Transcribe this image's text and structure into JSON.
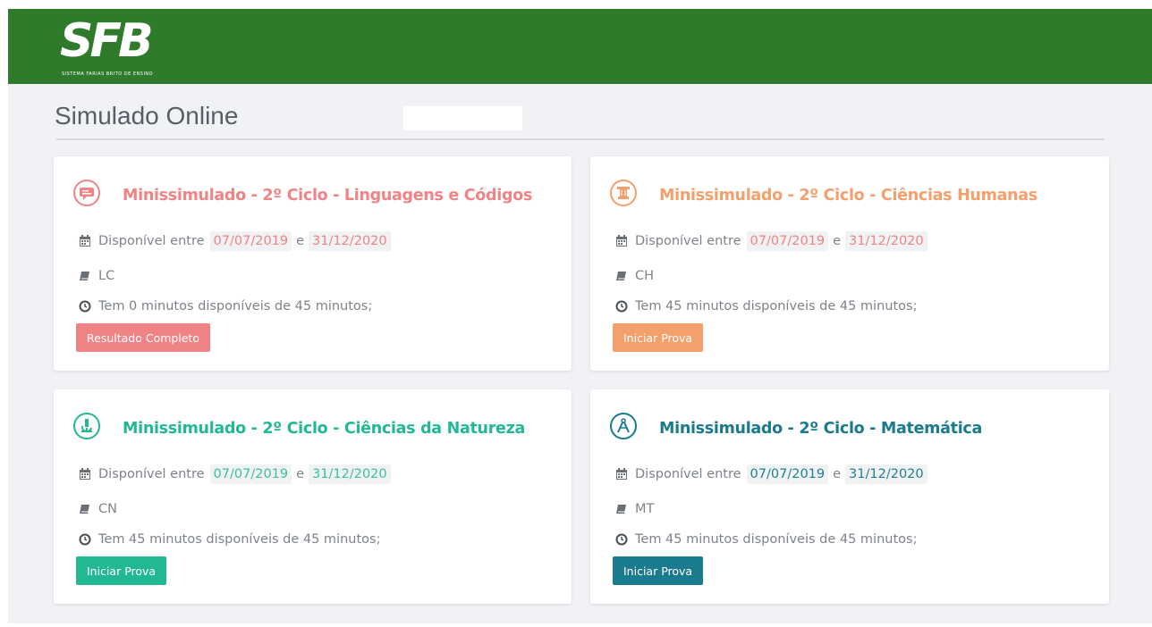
{
  "header": {
    "logo_text": "SFB",
    "logo_tagline": "SISTEMA FARIAS BRITO DE ENSINO",
    "bg_color": "#2f7b2b"
  },
  "page": {
    "title": "Simulado Online"
  },
  "cards": [
    {
      "title": "Minissimulado - 2º Ciclo - Linguagens e Códigos",
      "icon": "speech-bubble-icon",
      "accent": "#f08386",
      "available_label": "Disponível entre",
      "date_start": "07/07/2019",
      "date_sep": "e",
      "date_end": "31/12/2020",
      "code": "LC",
      "time_text": "Tem 0 minutos disponíveis de 45 minutos;",
      "button_label": "Resultado Completo"
    },
    {
      "title": "Minissimulado - 2º Ciclo - Ciências Humanas",
      "icon": "column-pillar-icon",
      "accent": "#f3a06c",
      "available_label": "Disponível entre",
      "date_start": "07/07/2019",
      "date_sep": "e",
      "date_end": "31/12/2020",
      "code": "CH",
      "time_text": "Tem 45 minutos disponíveis de 45 minutos;",
      "button_label": "Iniciar Prova"
    },
    {
      "title": "Minissimulado - 2º Ciclo - Ciências da Natureza",
      "icon": "microscope-icon",
      "accent": "#22b893",
      "available_label": "Disponível entre",
      "date_start": "07/07/2019",
      "date_sep": "e",
      "date_end": "31/12/2020",
      "code": "CN",
      "time_text": "Tem 45 minutos disponíveis de 45 minutos;",
      "button_label": "Iniciar Prova"
    },
    {
      "title": "Minissimulado - 2º Ciclo - Matemática",
      "icon": "compass-icon",
      "accent": "#1a7a8e",
      "available_label": "Disponível entre",
      "date_start": "07/07/2019",
      "date_sep": "e",
      "date_end": "31/12/2020",
      "code": "MT",
      "time_text": "Tem 45 minutos disponíveis de 45 minutos;",
      "button_label": "Iniciar Prova"
    }
  ]
}
